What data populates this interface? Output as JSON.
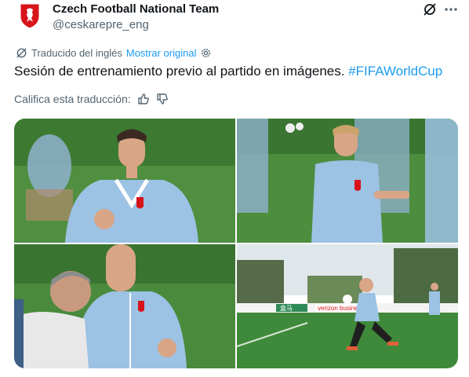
{
  "author": {
    "name": "Czech Football National Team",
    "handle": "@ceskarepre_eng"
  },
  "translation": {
    "label": "Traducido del inglés",
    "show_original": "Mostrar original"
  },
  "tweet": {
    "text": "Sesión de entrenamiento previo al partido en imágenes. ",
    "hashtag": "#FIFAWorldCup"
  },
  "rating": {
    "label": "Califica esta traducción:"
  },
  "media": {
    "photos": [
      {
        "description": "player-smiling-fist"
      },
      {
        "description": "player-pointing"
      },
      {
        "description": "players-talking"
      },
      {
        "description": "player-stretching-field"
      }
    ],
    "banner_text": "verizon business",
    "board_text": "盒马"
  },
  "colors": {
    "accent": "#1d9bf0",
    "muted": "#536471",
    "crest_red": "#d7141a",
    "shirt": "#8fb8de",
    "pitch": "#3f8a3a"
  },
  "icons": [
    "czech-crest-icon",
    "grok-icon",
    "more-icon",
    "translate-icon",
    "gear-icon",
    "thumbs-up-icon",
    "thumbs-down-icon"
  ]
}
